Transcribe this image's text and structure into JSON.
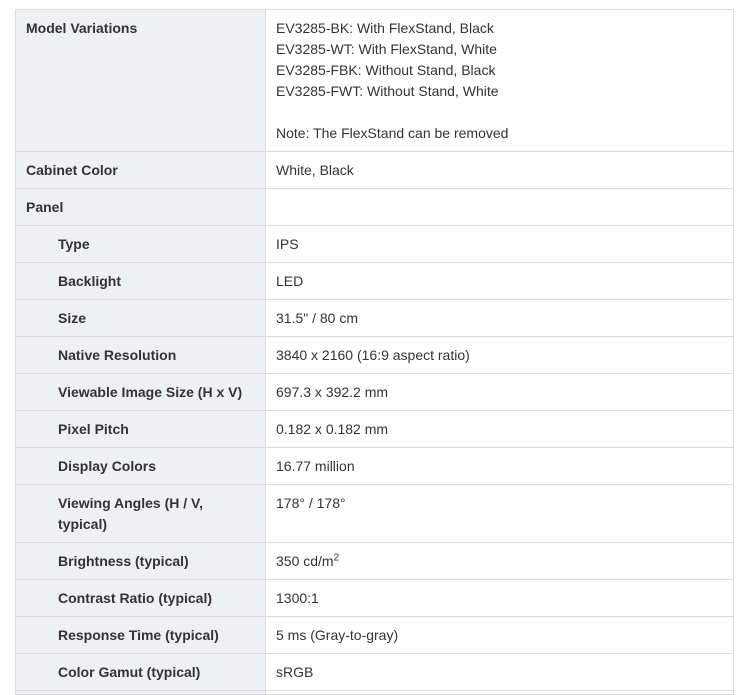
{
  "rows": [
    {
      "label": "Model Variations",
      "lines": [
        "EV3285-BK: With FlexStand, Black",
        "EV3285-WT: With FlexStand, White",
        "EV3285-FBK: Without Stand, Black",
        "EV3285-FWT: Without Stand, White",
        "",
        "Note: The FlexStand can be removed"
      ]
    },
    {
      "label": "Cabinet Color",
      "value": "White, Black"
    },
    {
      "label": "Panel",
      "value": ""
    },
    {
      "label": "Type",
      "value": "IPS"
    },
    {
      "label": "Backlight",
      "value": "LED"
    },
    {
      "label": "Size",
      "value": "31.5\" / 80 cm"
    },
    {
      "label": "Native Resolution",
      "value": "3840 x 2160 (16:9 aspect ratio)"
    },
    {
      "label": "Viewable Image Size (H x V)",
      "value": "697.3 x 392.2 mm"
    },
    {
      "label": "Pixel Pitch",
      "value": "0.182 x 0.182 mm"
    },
    {
      "label": "Display Colors",
      "value": "16.77 million"
    },
    {
      "label": "Viewing Angles (H / V, typical)",
      "label_lines": [
        "Viewing Angles (H / V,",
        "typical)"
      ],
      "value": "178° / 178°"
    },
    {
      "label": "Brightness (typical)",
      "value": "350 cd/m",
      "value_sup": "2"
    },
    {
      "label": "Contrast Ratio (typical)",
      "value": "1300:1"
    },
    {
      "label": "Response Time (typical)",
      "value": "5 ms (Gray-to-gray)"
    },
    {
      "label": "Color Gamut (typical)",
      "value": "sRGB"
    }
  ]
}
